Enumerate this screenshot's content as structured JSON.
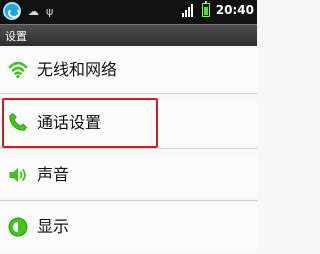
{
  "status_bar": {
    "time": "20:40",
    "notification_glyphs": [
      "☁",
      "ψ"
    ]
  },
  "title_bar": {
    "title": "设置"
  },
  "settings": {
    "items": [
      {
        "label": "无线和网络",
        "icon": "wifi-icon"
      },
      {
        "label": "通话设置",
        "icon": "phone-icon"
      },
      {
        "label": "声音",
        "icon": "speaker-icon"
      },
      {
        "label": "显示",
        "icon": "display-icon"
      }
    ]
  },
  "colors": {
    "status_bar_bg": "#111111",
    "title_bar_bg": "#3a3a3a",
    "list_bg": "#fbfbfb",
    "icon_green": "#3fc51a",
    "highlight_border": "#c6221f"
  }
}
